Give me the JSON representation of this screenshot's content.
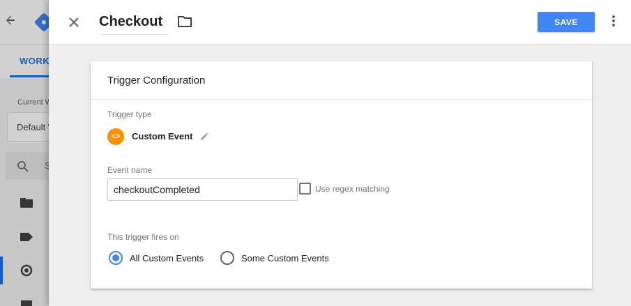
{
  "background": {
    "tab_partial": "WORKS",
    "workspace_label_partial": "Current W",
    "workspace_value_partial": "Default W",
    "search_partial": "S",
    "icons": [
      "back-arrow-icon",
      "gtm-logo-icon",
      "search-icon",
      "folder-nav-icon",
      "tag-icon",
      "trigger-icon",
      "calendar-icon"
    ]
  },
  "header": {
    "title": "Checkout",
    "save_label": "SAVE",
    "icons": [
      "close-icon",
      "folder-icon",
      "more-vert-icon"
    ]
  },
  "card": {
    "title": "Trigger Configuration",
    "trigger_type_label": "Trigger type",
    "trigger_type_icon_glyph": "<>",
    "trigger_type_value": "Custom Event",
    "event_name_label": "Event name",
    "event_name_value": "checkoutCompleted",
    "regex_label": "Use regex matching",
    "regex_checked": false,
    "fires_on_label": "This trigger fires on",
    "fires_on_options": [
      {
        "label": "All Custom Events",
        "selected": true
      },
      {
        "label": "Some Custom Events",
        "selected": false
      }
    ]
  },
  "colors": {
    "accent": "#4285f4",
    "trigger_icon": "#ff8f00",
    "nav_active": "#1a73e8"
  }
}
